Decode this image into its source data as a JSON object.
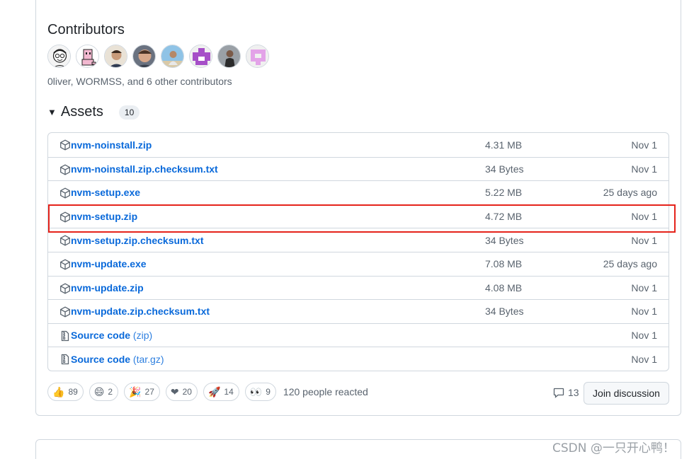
{
  "contributors": {
    "title": "Contributors",
    "summary": "0liver, WORMSS, and 6 other contributors",
    "avatars": [
      "avatar-1",
      "avatar-2",
      "avatar-3",
      "avatar-4",
      "avatar-5",
      "avatar-6",
      "avatar-7",
      "avatar-8"
    ]
  },
  "assets": {
    "title": "Assets",
    "count": "10",
    "items": [
      {
        "name": "nvm-noinstall.zip",
        "size": "4.31 MB",
        "date": "Nov 1",
        "icon": "package-icon"
      },
      {
        "name": "nvm-noinstall.zip.checksum.txt",
        "size": "34 Bytes",
        "date": "Nov 1",
        "icon": "package-icon"
      },
      {
        "name": "nvm-setup.exe",
        "size": "5.22 MB",
        "date": "25 days ago",
        "icon": "package-icon"
      },
      {
        "name": "nvm-setup.zip",
        "size": "4.72 MB",
        "date": "Nov 1",
        "icon": "package-icon"
      },
      {
        "name": "nvm-setup.zip.checksum.txt",
        "size": "34 Bytes",
        "date": "Nov 1",
        "icon": "package-icon"
      },
      {
        "name": "nvm-update.exe",
        "size": "7.08 MB",
        "date": "25 days ago",
        "icon": "package-icon"
      },
      {
        "name": "nvm-update.zip",
        "size": "4.08 MB",
        "date": "Nov 1",
        "icon": "package-icon"
      },
      {
        "name": "nvm-update.zip.checksum.txt",
        "size": "34 Bytes",
        "date": "Nov 1",
        "icon": "package-icon"
      },
      {
        "name": "Source code",
        "suffix": "(zip)",
        "size": "",
        "date": "Nov 1",
        "icon": "file-zip-icon"
      },
      {
        "name": "Source code",
        "suffix": "(tar.gz)",
        "size": "",
        "date": "Nov 1",
        "icon": "file-zip-icon"
      }
    ]
  },
  "reactions": {
    "items": [
      {
        "emoji": "👍",
        "count": "89",
        "name": "thumbs-up"
      },
      {
        "emoji": "😄",
        "count": "2",
        "name": "smile"
      },
      {
        "emoji": "🎉",
        "count": "27",
        "name": "tada"
      },
      {
        "emoji": "❤",
        "count": "20",
        "name": "heart"
      },
      {
        "emoji": "🚀",
        "count": "14",
        "name": "rocket"
      },
      {
        "emoji": "👀",
        "count": "9",
        "name": "eyes"
      }
    ],
    "summary": "120 people reacted"
  },
  "discussion": {
    "comment_count": "13",
    "join_label": "Join discussion"
  },
  "watermark": "CSDN @一只开心鸭！",
  "colors": {
    "link": "#0969da",
    "muted": "#59636e",
    "border": "#d0d7de",
    "highlight": "#e5231b"
  }
}
